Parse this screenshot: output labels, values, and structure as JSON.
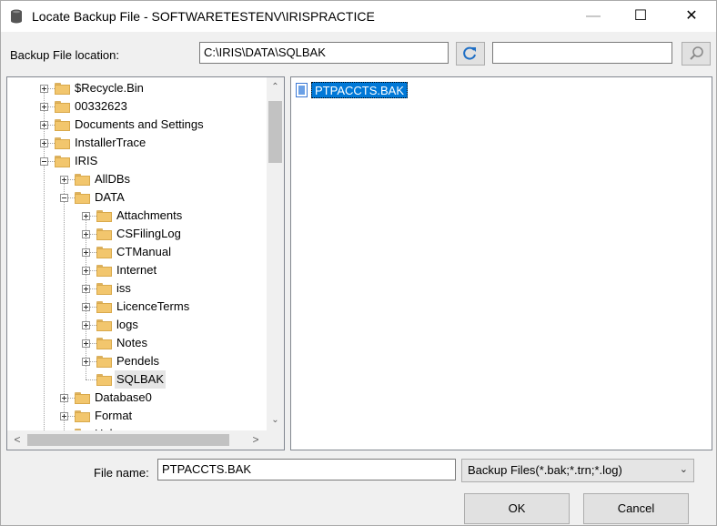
{
  "window": {
    "title": "Locate Backup File - SOFTWARETESTENV\\IRISPRACTICE",
    "minimize": "—",
    "maximize": "☐",
    "close": "✕"
  },
  "location": {
    "label": "Backup File location:",
    "path": "C:\\IRIS\\DATA\\SQLBAK",
    "refresh_icon": "refresh-icon",
    "search_value": "",
    "search_icon": "search-icon"
  },
  "tree": {
    "nodes": [
      {
        "label": "$Recycle.Bin",
        "level": 0,
        "expander": "plus"
      },
      {
        "label": "00332623",
        "level": 0,
        "expander": "plus"
      },
      {
        "label": "Documents and Settings",
        "level": 0,
        "expander": "plus"
      },
      {
        "label": "InstallerTrace",
        "level": 0,
        "expander": "plus"
      },
      {
        "label": "IRIS",
        "level": 0,
        "expander": "minus"
      },
      {
        "label": "AllDBs",
        "level": 1,
        "expander": "plus"
      },
      {
        "label": "DATA",
        "level": 1,
        "expander": "minus"
      },
      {
        "label": "Attachments",
        "level": 2,
        "expander": "plus"
      },
      {
        "label": "CSFilingLog",
        "level": 2,
        "expander": "plus"
      },
      {
        "label": "CTManual",
        "level": 2,
        "expander": "plus"
      },
      {
        "label": "Internet",
        "level": 2,
        "expander": "plus"
      },
      {
        "label": "iss",
        "level": 2,
        "expander": "plus"
      },
      {
        "label": "LicenceTerms",
        "level": 2,
        "expander": "plus"
      },
      {
        "label": "logs",
        "level": 2,
        "expander": "plus"
      },
      {
        "label": "Notes",
        "level": 2,
        "expander": "plus"
      },
      {
        "label": "Pendels",
        "level": 2,
        "expander": "plus"
      },
      {
        "label": "SQLBAK",
        "level": 2,
        "expander": "none",
        "selected": true
      },
      {
        "label": "Database0",
        "level": 1,
        "expander": "plus"
      },
      {
        "label": "Format",
        "level": 1,
        "expander": "plus"
      },
      {
        "label": "Help",
        "level": 1,
        "expander": "plus"
      }
    ],
    "scroll_up": "⌃",
    "scroll_down": "⌄",
    "scroll_left": "<",
    "scroll_right": ">"
  },
  "files": {
    "items": [
      {
        "label": "PTPACCTS.BAK",
        "selected": true
      }
    ]
  },
  "bottom": {
    "file_name_label": "File name:",
    "file_name_value": "PTPACCTS.BAK",
    "filter_value": "Backup Files(*.bak;*.trn;*.log)",
    "filter_chevron": "⌄",
    "ok_label": "OK",
    "cancel_label": "Cancel"
  },
  "colors": {
    "selection": "#0078d7",
    "folder": "#f2c66d"
  }
}
